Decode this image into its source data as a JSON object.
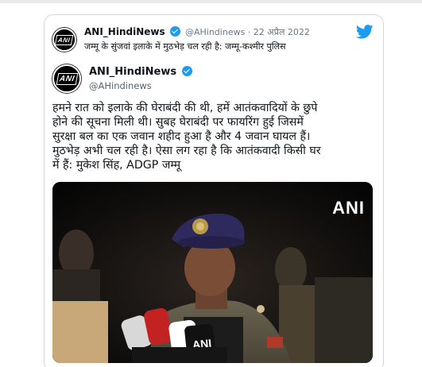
{
  "quoted_tweet": {
    "display_name": "ANI_HindiNews",
    "handle_date": "@AHindinews · 22 अप्रैल 2022",
    "text": "जम्मू के सुंजवां इलाके में मुठभेड़ चल रही है: जम्मू-कश्मीर पुलिस",
    "avatar_text": "ANI"
  },
  "tweet": {
    "display_name": "ANI_HindiNews",
    "handle": "@AHindinews",
    "avatar_text": "ANI",
    "text_lines": [
      "हमने रात को इलाके की घेराबंदी की थी, हमें आतंकवादियों के छुपे",
      "होने की सूचना मिली थी। सुबह घेराबंदी पर फायरिंग हुई जिसमें",
      "सुरक्षा बल का एक जवान शहीद हुआ है और 4 जवान घायल हैं।",
      "मुठभेड़ अभी चल रही है। ऐसा लग रहा है कि आतंकवादी किसी घर",
      "में हैं: मुकेश सिंह, ADGP जम्मू"
    ]
  },
  "media": {
    "watermark": "ANI",
    "mic_label": "ANI",
    "description": "Police officer speaking to microphones at night"
  },
  "colors": {
    "twitter_blue": "#1d9bf0",
    "handle_gray": "#536471",
    "beret": "#2e2a5e"
  }
}
